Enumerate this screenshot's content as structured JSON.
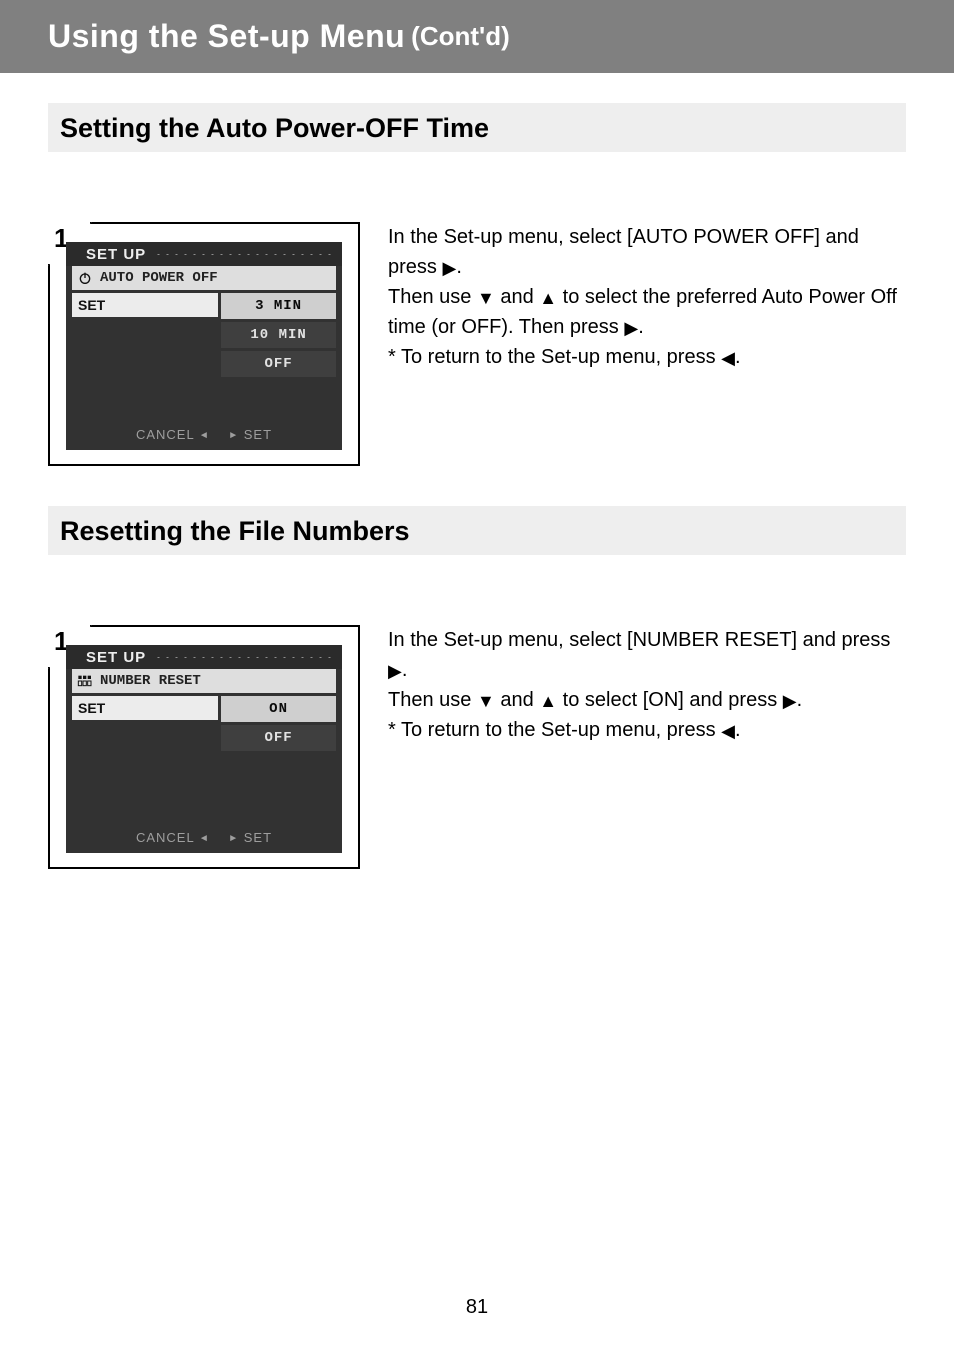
{
  "banner": {
    "title": "Using the Set-up Menu",
    "cont": "(Cont'd)"
  },
  "sectionA": {
    "title": "Setting the Auto Power-OFF Time"
  },
  "sectionB": {
    "title": "Resetting the File Numbers"
  },
  "shot1": {
    "step_number": "1",
    "top_label": "SET UP",
    "sub_label": "AUTO POWER OFF",
    "left_label": "SET",
    "options": [
      "3 MIN",
      "10 MIN",
      "OFF"
    ],
    "footer_cancel": "CANCEL",
    "footer_set": "SET"
  },
  "shot2": {
    "step_number": "1",
    "top_label": "SET UP",
    "sub_label": "NUMBER RESET",
    "left_label": "SET",
    "options": [
      "ON",
      "OFF"
    ],
    "footer_cancel": "CANCEL",
    "footer_set": "SET"
  },
  "instrA": {
    "line1a": "In the Set-up menu, select [AUTO POWER OFF] and press",
    "line1b": ".",
    "line2a": "Then use",
    "line2b": "and",
    "line2c": "to select the preferred Auto Power Off time (or OFF). Then press",
    "line2d": ".",
    "line3a": "* To return to the Set-up menu, press",
    "line3b": "."
  },
  "instrB": {
    "line1a": "In the Set-up menu, select [NUMBER RESET] and press",
    "line1b": ".",
    "line2a": "Then use",
    "line2b": "and",
    "line2c": "to select [ON] and press",
    "line2d": ".",
    "line3a": "* To return to the Set-up menu, press",
    "line3b": "."
  },
  "page_number": "81",
  "glyphs": {
    "down": "▼",
    "up": "▲",
    "right": "▶",
    "left": "◀",
    "tri_l": "◄",
    "tri_r": "►"
  }
}
